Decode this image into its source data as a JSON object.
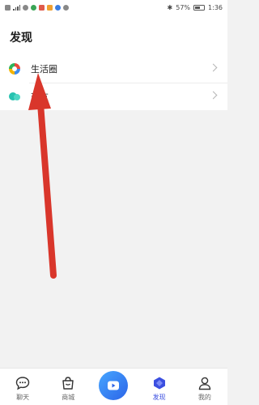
{
  "status_bar": {
    "battery_percent": "57%",
    "time": "1:36"
  },
  "header": {
    "title": "发现"
  },
  "list": {
    "items": [
      {
        "label": "生活圈",
        "icon": "life-circle-icon"
      },
      {
        "label": "交友",
        "icon": "friends-icon"
      }
    ]
  },
  "tabbar": {
    "tabs": [
      {
        "label": "聊天",
        "icon": "chat-icon"
      },
      {
        "label": "商城",
        "icon": "shop-icon"
      },
      {
        "label": "",
        "icon": "play-icon"
      },
      {
        "label": "发现",
        "icon": "discover-icon",
        "active": true
      },
      {
        "label": "我的",
        "icon": "profile-icon"
      }
    ]
  },
  "colors": {
    "accent": "#3b4fe0",
    "annotation_arrow": "#d9362b",
    "center_button": "#2c64e8"
  }
}
